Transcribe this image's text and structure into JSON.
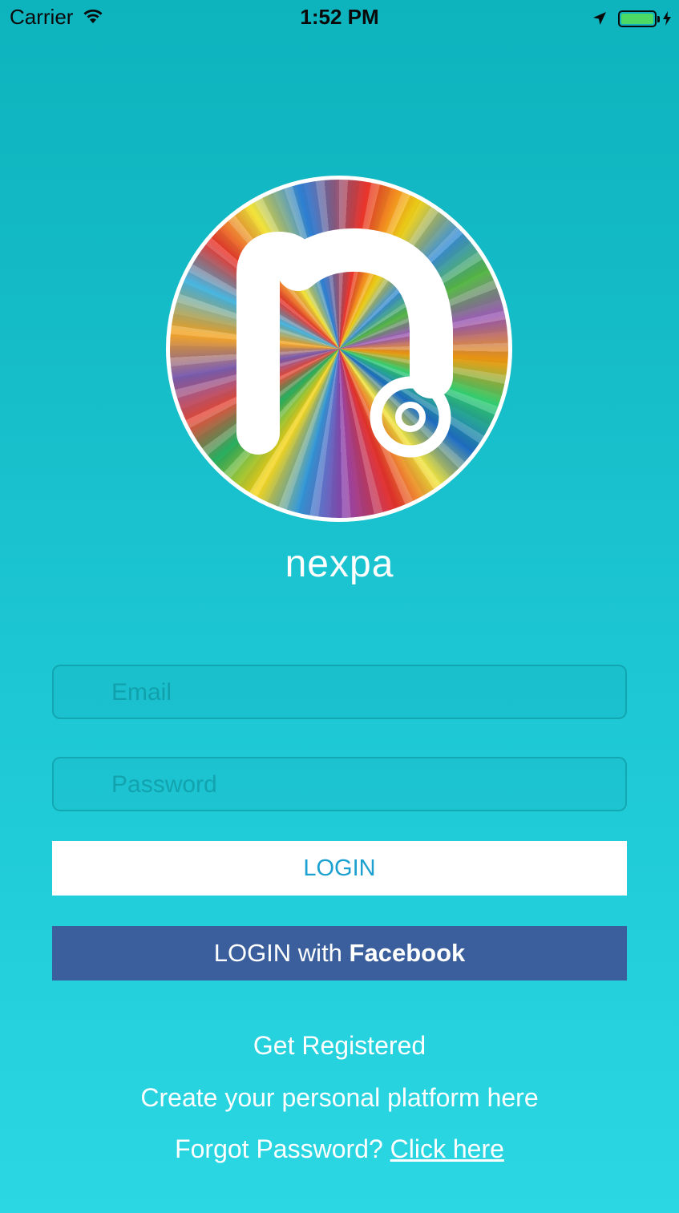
{
  "status_bar": {
    "carrier": "Carrier",
    "time": "1:52 PM"
  },
  "app": {
    "name": "nexpa"
  },
  "login_form": {
    "email_placeholder": "Email",
    "password_placeholder": "Password",
    "login_label": "LOGIN",
    "facebook_label_prefix": "LOGIN with ",
    "facebook_label_brand": "Facebook"
  },
  "footer": {
    "register_label": "Get Registered",
    "platform_text": "Create your personal platform here",
    "forgot_prefix": "Forgot Password? ",
    "forgot_link": "Click here"
  },
  "colors": {
    "background_top": "#0db3bd",
    "background_bottom": "#2ad7e2",
    "login_text": "#1ba0cf",
    "facebook_blue": "#3b5f9c",
    "battery_green": "#4cd964"
  },
  "icons": [
    "wifi-icon",
    "location-icon",
    "battery-icon",
    "charging-bolt-icon"
  ]
}
